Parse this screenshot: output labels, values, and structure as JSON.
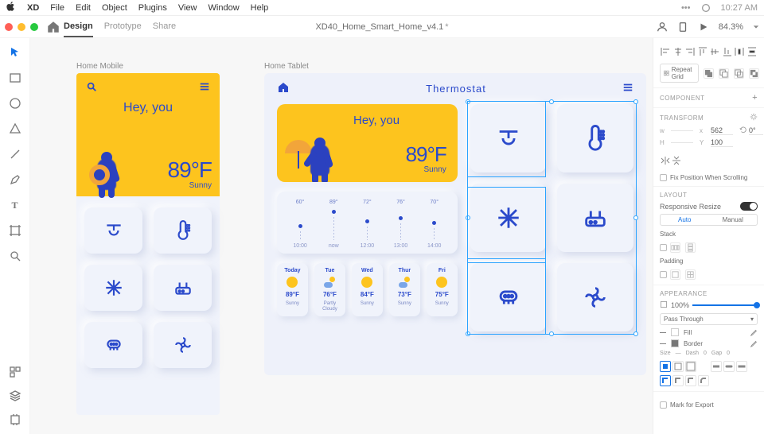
{
  "menubar": {
    "app": "XD",
    "items": [
      "File",
      "Edit",
      "Object",
      "Plugins",
      "View",
      "Window",
      "Help"
    ],
    "clock": "10:27 AM"
  },
  "titlebar": {
    "tabs": {
      "design": "Design",
      "prototype": "Prototype",
      "share": "Share"
    },
    "doc": "XD40_Home_Smart_Home_v4.1",
    "dirty": "*",
    "zoom": "84.3%"
  },
  "artboards": {
    "mobile": {
      "label": "Home Mobile",
      "hey": "Hey, you",
      "temp": "89°F",
      "cond": "Sunny"
    },
    "tablet": {
      "label": "Home Tablet",
      "title": "Thermostat",
      "hey": "Hey, you",
      "temp": "89°F",
      "cond": "Sunny"
    }
  },
  "hourly": [
    {
      "deg": "60°",
      "time": "10:00"
    },
    {
      "deg": "89°",
      "time": "now"
    },
    {
      "deg": "72°",
      "time": "12:00"
    },
    {
      "deg": "76°",
      "time": "13:00"
    },
    {
      "deg": "70°",
      "time": "14:00"
    }
  ],
  "daily": [
    {
      "dow": "Today",
      "temp": "89°F",
      "cond": "Sunny",
      "icon": "sun"
    },
    {
      "dow": "Tue",
      "temp": "76°F",
      "cond": "Partly Cloudy",
      "icon": "cloudsun"
    },
    {
      "dow": "Wed",
      "temp": "84°F",
      "cond": "Sunny",
      "icon": "sun"
    },
    {
      "dow": "Thur",
      "temp": "73°F",
      "cond": "Sunny",
      "icon": "cloudsun"
    },
    {
      "dow": "Fri",
      "temp": "75°F",
      "cond": "Sunny",
      "icon": "sun"
    }
  ],
  "props": {
    "repeatGrid": "Repeat Grid",
    "componentTitle": "COMPONENT",
    "transformTitle": "TRANSFORM",
    "w": "",
    "x": "562",
    "h": "",
    "y": "100",
    "rotation": "0°",
    "fixPos": "Fix Position When Scrolling",
    "layoutTitle": "LAYOUT",
    "responsive": "Responsive Resize",
    "segAuto": "Auto",
    "segManual": "Manual",
    "stack": "Stack",
    "padding": "Padding",
    "appearanceTitle": "APPEARANCE",
    "opacity": "100%",
    "blend": "Pass Through",
    "fill": "Fill",
    "border": "Border",
    "sizeLbl": "Size",
    "dashLbl": "Dash",
    "dashVal": "0",
    "gapLbl": "Gap",
    "gapVal": "0",
    "markExport": "Mark for Export"
  }
}
